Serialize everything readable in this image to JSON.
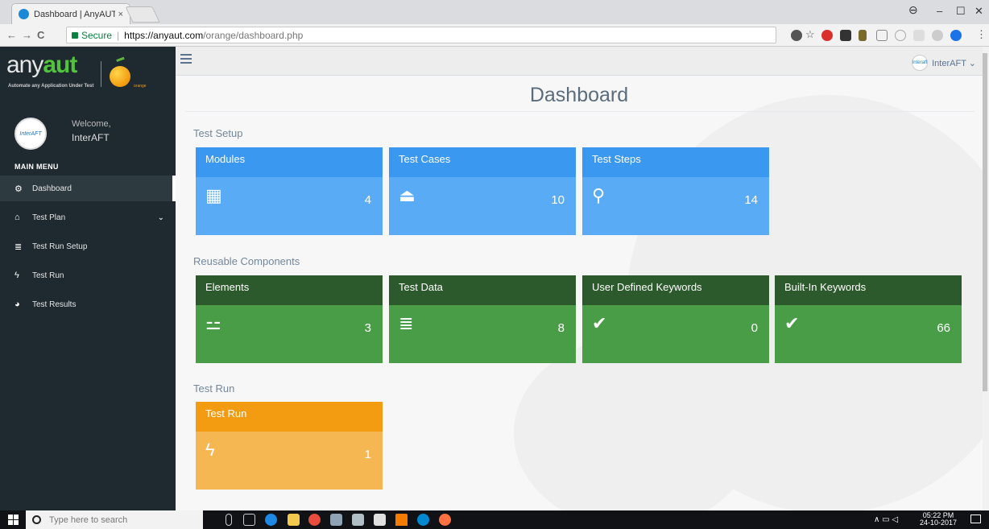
{
  "browser": {
    "tab_title": "Dashboard | AnyAUT",
    "tab_close": "×",
    "secure_label": "Secure",
    "url_host": "https://anyaut.com",
    "url_path": "/orange/dashboard.php",
    "win_min": "–",
    "win_max": "☐",
    "win_close": "✕",
    "back": "←",
    "forward": "→",
    "reload": "C",
    "profile_icon": "user-circle-icon"
  },
  "sidebar": {
    "logo_text_plain": "any",
    "logo_text_bold": "aut",
    "logo_tagline": "Automate any Application Under Test",
    "logo_sub": "orange",
    "welcome": "Welcome,",
    "username": "InterAFT",
    "avatar_text": "InterAFT",
    "menu_title": "MAIN MENU",
    "items": [
      {
        "label": "Dashboard",
        "icon": "⚙"
      },
      {
        "label": "Test Plan",
        "icon": "⌂"
      },
      {
        "label": "Test Run Setup",
        "icon": "≣"
      },
      {
        "label": "Test Run",
        "icon": "ϟ"
      },
      {
        "label": "Test Results",
        "icon": "◕"
      }
    ]
  },
  "topnav": {
    "user": "InterAFT ⌄",
    "avatar_text": "interaft"
  },
  "page": {
    "title": "Dashboard"
  },
  "sections": {
    "setup": "Test Setup",
    "reusable": "Reusable Components",
    "run": "Test Run"
  },
  "cards": {
    "modules": {
      "title": "Modules",
      "count": "4",
      "icon": "▦"
    },
    "test_cases": {
      "title": "Test Cases",
      "count": "10",
      "icon": "⏏"
    },
    "test_steps": {
      "title": "Test Steps",
      "count": "14",
      "icon": "⚲"
    },
    "elements": {
      "title": "Elements",
      "count": "3",
      "icon": "⚍"
    },
    "test_data": {
      "title": "Test Data",
      "count": "8",
      "icon": "≣"
    },
    "udk": {
      "title": "User Defined Keywords",
      "count": "0",
      "icon": "✔"
    },
    "bik": {
      "title": "Built-In Keywords",
      "count": "66",
      "icon": "✔"
    },
    "test_run": {
      "title": "Test Run",
      "count": "1",
      "icon": "ϟ"
    }
  },
  "taskbar": {
    "search_placeholder": "Type here to search",
    "time": "05:22 PM",
    "date": "24-10-2017",
    "tray": "∧ ▭ ◁"
  }
}
